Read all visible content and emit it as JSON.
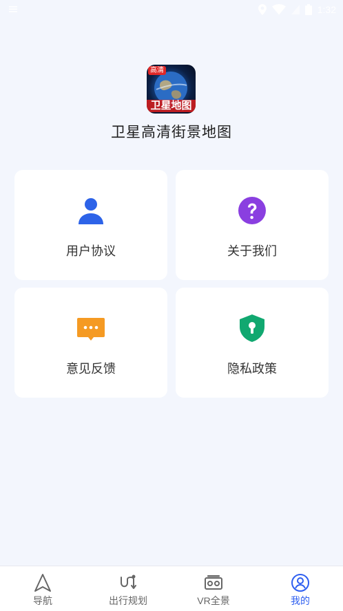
{
  "status_bar": {
    "time": "1:32"
  },
  "app": {
    "name": "卫星高清街景地图",
    "logo_badge": "高清",
    "logo_caption": "卫星地图"
  },
  "menu": [
    {
      "label": "用户协议",
      "icon": "user-icon",
      "color": "#2d63e8"
    },
    {
      "label": "关于我们",
      "icon": "question-icon",
      "color": "#8a3fe0"
    },
    {
      "label": "意见反馈",
      "icon": "chat-bubble-icon",
      "color": "#f59a23"
    },
    {
      "label": "隐私政策",
      "icon": "shield-lock-icon",
      "color": "#11a870"
    }
  ],
  "bottom_nav": {
    "items": [
      {
        "label": "导航",
        "icon": "navigation-arrow-icon"
      },
      {
        "label": "出行规划",
        "icon": "route-icon"
      },
      {
        "label": "VR全景",
        "icon": "vr-headset-icon"
      },
      {
        "label": "我的",
        "icon": "profile-icon"
      }
    ],
    "active_label": "我的",
    "active_color": "#2d5ef0"
  }
}
